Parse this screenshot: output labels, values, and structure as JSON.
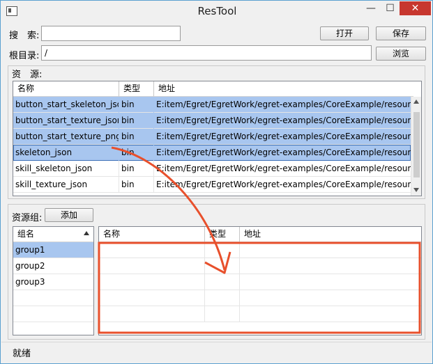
{
  "window": {
    "title": "ResTool",
    "minimize": "—",
    "maximize": "☐",
    "close": "✕"
  },
  "search": {
    "label": "搜　索:",
    "value": "",
    "open_button": "打开",
    "save_button": "保存"
  },
  "root": {
    "label": "根目录:",
    "value": "/",
    "browse_button": "浏览"
  },
  "resources": {
    "label": "资　源:",
    "columns": [
      "名称",
      "类型",
      "地址"
    ],
    "rows": [
      {
        "name": "button_start_skeleton_json",
        "type": "bin",
        "path": "E:item/Egret/EgretWork/egret-examples/CoreExample/resources/a"
      },
      {
        "name": "button_start_texture_json",
        "type": "bin",
        "path": "E:item/Egret/EgretWork/egret-examples/CoreExample/resources/a"
      },
      {
        "name": "button_start_texture_png",
        "type": "bin",
        "path": "E:item/Egret/EgretWork/egret-examples/CoreExample/resources/a"
      },
      {
        "name": "skeleton_json",
        "type": "bin",
        "path": "E:item/Egret/EgretWork/egret-examples/CoreExample/resources/a"
      },
      {
        "name": "skill_skeleton_json",
        "type": "bin",
        "path": "E:item/Egret/EgretWork/egret-examples/CoreExample/resources/a"
      },
      {
        "name": "skill_texture_json",
        "type": "bin",
        "path": "E:item/Egret/EgretWork/egret-examples/CoreExample/resources/a"
      }
    ]
  },
  "resource_groups": {
    "label": "资源组:",
    "add_button": "添加",
    "group_header": "组名",
    "groups": [
      "group1",
      "group2",
      "group3"
    ],
    "detail_columns": [
      "名称",
      "类型",
      "地址"
    ]
  },
  "status": {
    "text": "就绪"
  },
  "colors": {
    "selection": "#a8c6ef",
    "annotation": "#e8502c",
    "close_button": "#c7372f"
  },
  "icons": [
    "app-icon",
    "sort-ascending-icon",
    "scroll-up-icon",
    "scroll-down-icon",
    "drag-arrow-annotation"
  ]
}
